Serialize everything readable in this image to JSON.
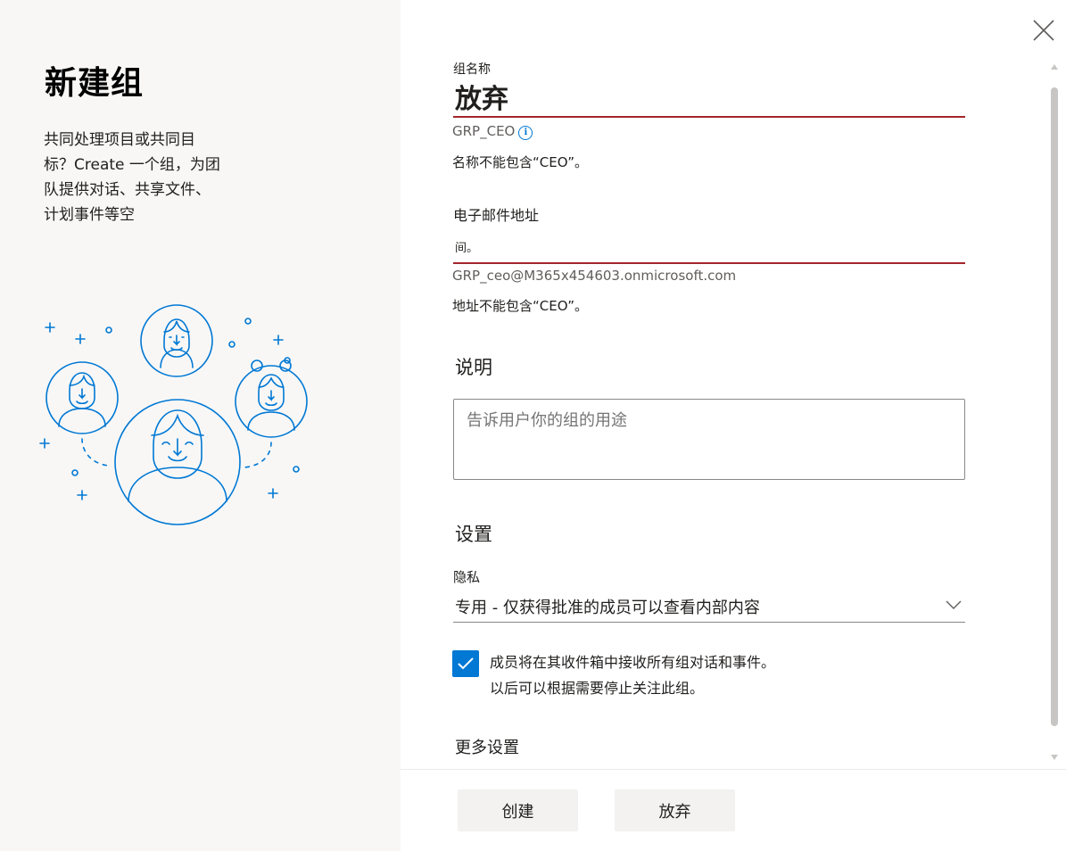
{
  "panel": {
    "title": "新建组",
    "description": "共同处理项目或共同目标？Create 一个组，为团队提供对话、共享文件、计划事件等空"
  },
  "form": {
    "group_name": {
      "label": "组名称",
      "value": "放弃",
      "alias_hint": "GRP_CEO",
      "error": "名称不能包含“CEO”。"
    },
    "email": {
      "label": "电子邮件地址",
      "value": "间。",
      "address_hint": "GRP_ceo@M365x454603.onmicrosoft.com",
      "error": "地址不能包含“CEO”。"
    },
    "description": {
      "heading": "说明",
      "placeholder": "告诉用户你的组的用途"
    },
    "settings": {
      "heading": "设置",
      "privacy_label": "隐私",
      "privacy_value": "专用 - 仅获得批准的成员可以查看内部内容",
      "subscribe_checked": true,
      "subscribe_label": "成员将在其收件箱中接收所有组对话和事件。以后可以根据需要停止关注此组。",
      "more_settings": "更多设置"
    }
  },
  "buttons": {
    "create": "创建",
    "discard": "放弃"
  },
  "icons": {
    "close": "close-icon",
    "info": "info-icon",
    "chevron": "chevron-down-icon",
    "check": "checkmark-icon"
  },
  "colors": {
    "accent": "#0078d4",
    "error_underline": "#a4262c",
    "illustration": "#0078d4",
    "left_panel_bg": "#f8f7f6"
  }
}
